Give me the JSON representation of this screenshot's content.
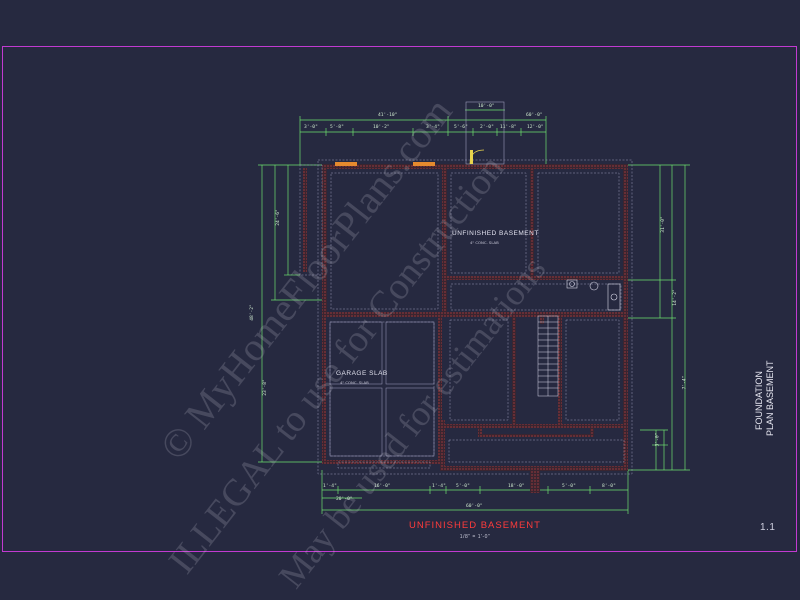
{
  "sheet": {
    "title": "UNFINISHED BASEMENT",
    "scale": "1/8\" = 1'-0\"",
    "sheet_number": "1.1",
    "sheet_title_line1": "FOUNDATION",
    "sheet_title_line2": "PLAN BASEMENT"
  },
  "rooms": {
    "basement": {
      "name": "UNFINISHED BASEMENT",
      "sub": "4\" CONC. SLAB"
    },
    "garage": {
      "name": "GARAGE SLAB",
      "sub": "4\" CONC. SLAB"
    }
  },
  "dimensions": {
    "top_outer": [
      "41'-10\"",
      "60'-0\""
    ],
    "top_inner": [
      "3'-0\"",
      "5'-8\"",
      "10'-2\"",
      "3'-4\"",
      "5'-6\"",
      "2'-0\"",
      "11'-8\"",
      "12'-0\""
    ],
    "bump": "10'-0\"",
    "bottom_inner": [
      "1'-4\"",
      "16'-0\"",
      "1'-4\"",
      "5'-0\"",
      "18'-0\"",
      "5'-0\"",
      "8'-0\""
    ],
    "bottom_outer": [
      "20'-0\"",
      "60'-0\""
    ],
    "left_outer": [
      "24'-6\"",
      "48'-2\"",
      "23'-8\""
    ],
    "right_outer": [
      "31'-0\"",
      "14'-2\"",
      "3'-0\"",
      "7'-4\""
    ]
  },
  "watermarks": [
    "© MyHomeFloorPlans.com",
    "ILLEGAL to use for Construction",
    "May be used for estimations"
  ]
}
